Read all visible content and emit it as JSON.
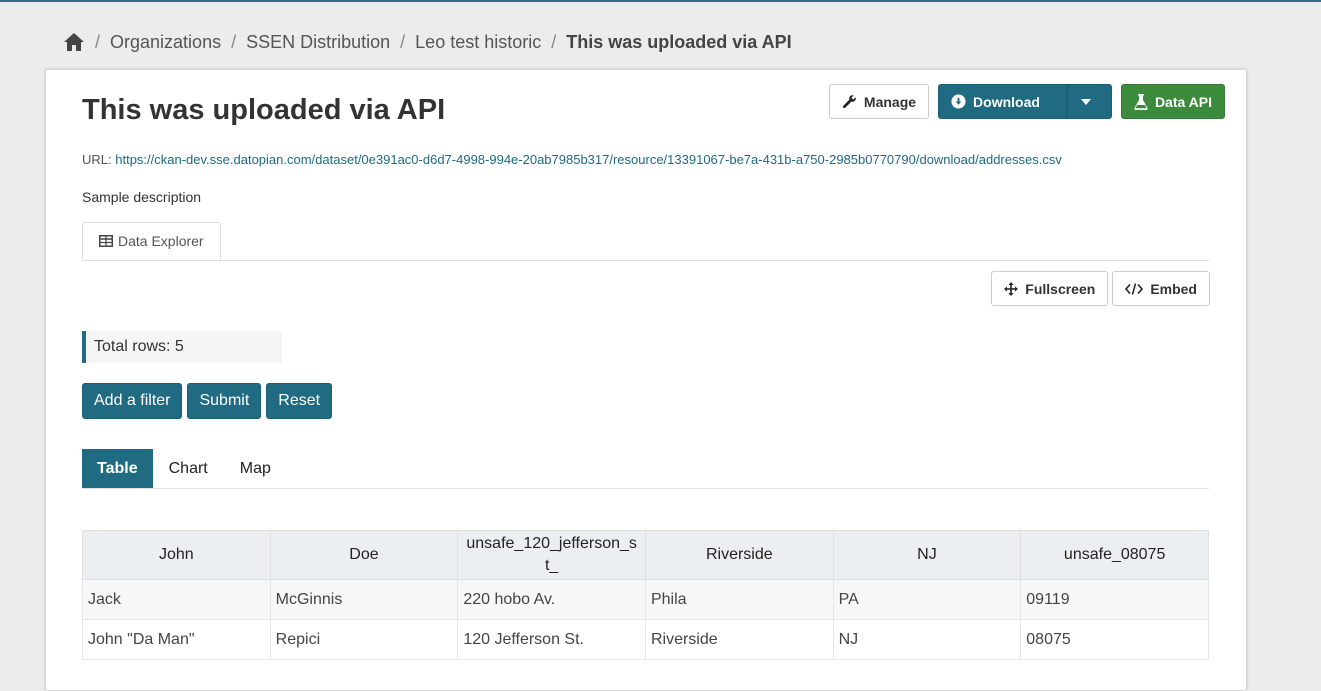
{
  "breadcrumb": {
    "items": [
      "Organizations",
      "SSEN Distribution",
      "Leo test historic"
    ],
    "current": "This was uploaded via API",
    "separator": "/"
  },
  "resource": {
    "title": "This was uploaded via API",
    "url_label": "URL:",
    "url": "https://ckan-dev.sse.datopian.com/dataset/0e391ac0-d6d7-4998-994e-20ab7985b317/resource/13391067-be7a-431b-a750-2985b0770790/download/addresses.csv",
    "description": "Sample description"
  },
  "actions": {
    "manage": "Manage",
    "download": "Download",
    "data_api": "Data API"
  },
  "explorer": {
    "tab_label": "Data Explorer",
    "fullscreen": "Fullscreen",
    "embed": "Embed",
    "total_rows": "Total rows: 5",
    "add_filter": "Add a filter",
    "submit": "Submit",
    "reset": "Reset",
    "view_tabs": [
      "Table",
      "Chart",
      "Map"
    ]
  },
  "table": {
    "headers": [
      "John",
      "Doe",
      "unsafe_120_jefferson_st_",
      "Riverside",
      "NJ",
      "unsafe_08075"
    ],
    "rows": [
      [
        "Jack",
        "McGinnis",
        "220 hobo Av.",
        "Phila",
        "PA",
        "09119"
      ],
      [
        "John \"Da Man\"",
        "Repici",
        "120 Jefferson St.",
        "Riverside",
        "NJ",
        "08075"
      ]
    ]
  },
  "colors": {
    "primary": "#206b82",
    "success": "#3c8a3c",
    "background": "#ececec"
  }
}
